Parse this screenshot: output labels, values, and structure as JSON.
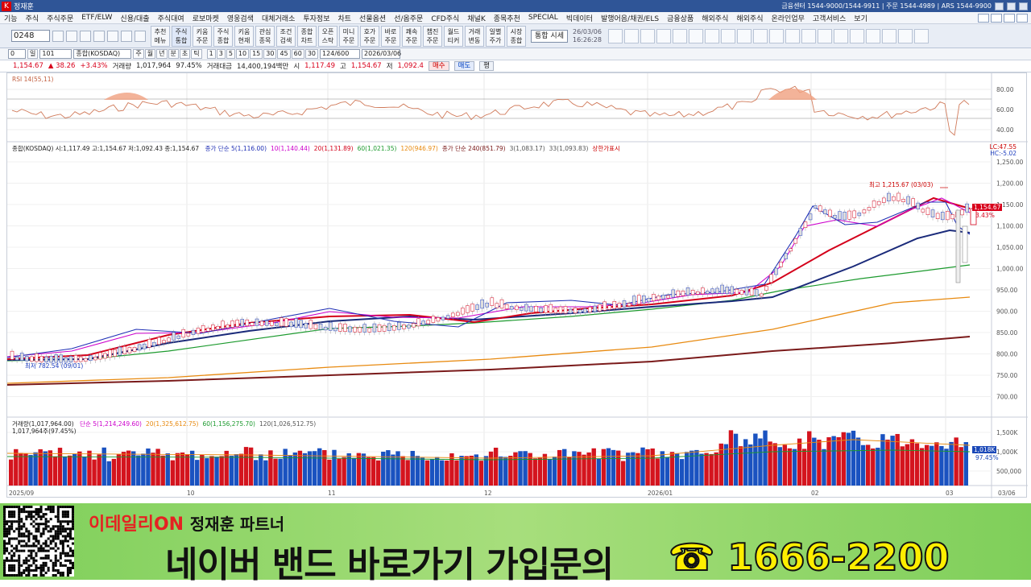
{
  "window": {
    "title": "정재훈",
    "contacts": "금융센터 1544-9000/1544-9911  |  주문 1544-4989  |  ARS 1544-9900"
  },
  "menu": [
    "기능",
    "주식",
    "주식주문",
    "ETF/ELW",
    "신용/대출",
    "주식대여",
    "로보마켓",
    "영웅검색",
    "대체거래소",
    "투자정보",
    "차트",
    "선물옵션",
    "선/옵주문",
    "CFD주식",
    "채널K",
    "종목추천",
    "SPECIAL",
    "빅데이터",
    "발행어음/채권/ELS",
    "금융상품",
    "해외주식",
    "해외주식",
    "온라인업무",
    "고객서비스",
    "보기"
  ],
  "toolbar": {
    "code": "0248",
    "buttons": [
      [
        "추천",
        "메뉴"
      ],
      [
        "주식",
        "통합"
      ],
      [
        "키움",
        "주문"
      ],
      [
        "주식",
        "종합"
      ],
      [
        "키움",
        "현재"
      ],
      [
        "관심",
        "종목"
      ],
      [
        "조건",
        "검색"
      ],
      [
        "종합",
        "차트"
      ],
      [
        "오픈",
        "스탁"
      ],
      [
        "미니",
        "주문"
      ],
      [
        "호가",
        "주문"
      ],
      [
        "바로",
        "주문"
      ],
      [
        "쾌속",
        "주문"
      ],
      [
        "챕진",
        "주문"
      ],
      [
        "월드",
        "티커"
      ],
      [
        "거래",
        "변동"
      ],
      [
        "일별",
        "주가"
      ],
      [
        "시장",
        "종합"
      ]
    ],
    "trade_label": "통합 시세",
    "date": "26/03/06",
    "time": "16:26:28"
  },
  "row3": {
    "code": "0",
    "period_label": "일",
    "index_code": "101",
    "index_name": "종합(KOSDAQ)",
    "periods": [
      "주",
      "월",
      "년",
      "분",
      "초",
      "틱"
    ],
    "minutes": [
      "1",
      "3",
      "5",
      "10",
      "15",
      "30",
      "45",
      "60",
      "30"
    ],
    "count": "124",
    "total": "600",
    "date": "2026/03/06"
  },
  "row4": {
    "price": "1,154.67",
    "change": "▲ 38.26",
    "change_pct": "+3.43%",
    "volume_label": "거래량",
    "volume": "1,017,964",
    "volume_pct": "97.45%",
    "amount_label": "거래대금",
    "amount": "14,400,194백만",
    "open_label": "시",
    "open": "1,117.49",
    "high_label": "고",
    "high": "1,154.67",
    "low_label": "저",
    "low": "1,092.4",
    "buy": "매수",
    "sell": "매도",
    "flat": "평"
  },
  "chart": {
    "rsi_legend": "RSI 14(55,11)",
    "rsi_ticks": [
      "80.00",
      "60.00",
      "40.00"
    ],
    "price_legend": "종합(KOSDAQ) 시:1,117.49 고:1,154.67 저:1,092.43 종:1,154.67",
    "ma_legend": [
      {
        "text": "종가 단순 5(1,116.00)",
        "color": "#1f2fb5"
      },
      {
        "text": "10(1,140.44)",
        "color": "#cc00cc"
      },
      {
        "text": "20(1,131.89)",
        "color": "#d4001a"
      },
      {
        "text": "60(1,021.35)",
        "color": "#1c9a2e"
      },
      {
        "text": "120(946.97)",
        "color": "#e88a10"
      },
      {
        "text": "종가 단순 240(851.79)",
        "color": "#7a1a1a"
      },
      {
        "text": "3(1,083.17)",
        "color": "#555"
      },
      {
        "text": "33(1,093.83)",
        "color": "#555"
      },
      {
        "text": "상한가표시",
        "color": "#cc0000"
      }
    ],
    "price_ticks": [
      "1,250.00",
      "1,200.00",
      "1,150.00",
      "1,100.00",
      "1,050.00",
      "1,000.00",
      "950.00",
      "900.00",
      "850.00",
      "800.00",
      "750.00",
      "700.00"
    ],
    "lc": "LC:47.55",
    "hc": "HC:-5.02",
    "last_price": "1,154.67",
    "last_pct": "3.43%",
    "high_note": "최고 1,215.67 (03/03)",
    "low_note": "최저 782.54 (09/01)",
    "volume_legend": "거래량(1,017,964.00)",
    "volume_ma_legend": [
      {
        "text": "단순 5(1,214,249.60)",
        "color": "#cc00cc"
      },
      {
        "text": "20(1,325,612.75)",
        "color": "#e88a10"
      },
      {
        "text": "60(1,156,275.70)",
        "color": "#1c9a2e"
      },
      {
        "text": "120(1,026,512.75)",
        "color": "#555"
      }
    ],
    "volume_sub": "1,017,964주(97.45%)",
    "volume_ticks": [
      "1,500K",
      "1,000K",
      "500,000"
    ],
    "volume_tag": "1,018K",
    "volume_tag_pct": "97.45%",
    "x_ticks": [
      "2025/09",
      "10",
      "11",
      "12",
      "2026/01",
      "02",
      "03",
      "03/06"
    ]
  },
  "banner": {
    "brand": "이데일리",
    "on": "ON",
    "partner": "정재훈 파트너",
    "headline": "네이버 밴드 바로가기  가입문의",
    "phone": "☎ 1666-2200"
  }
}
